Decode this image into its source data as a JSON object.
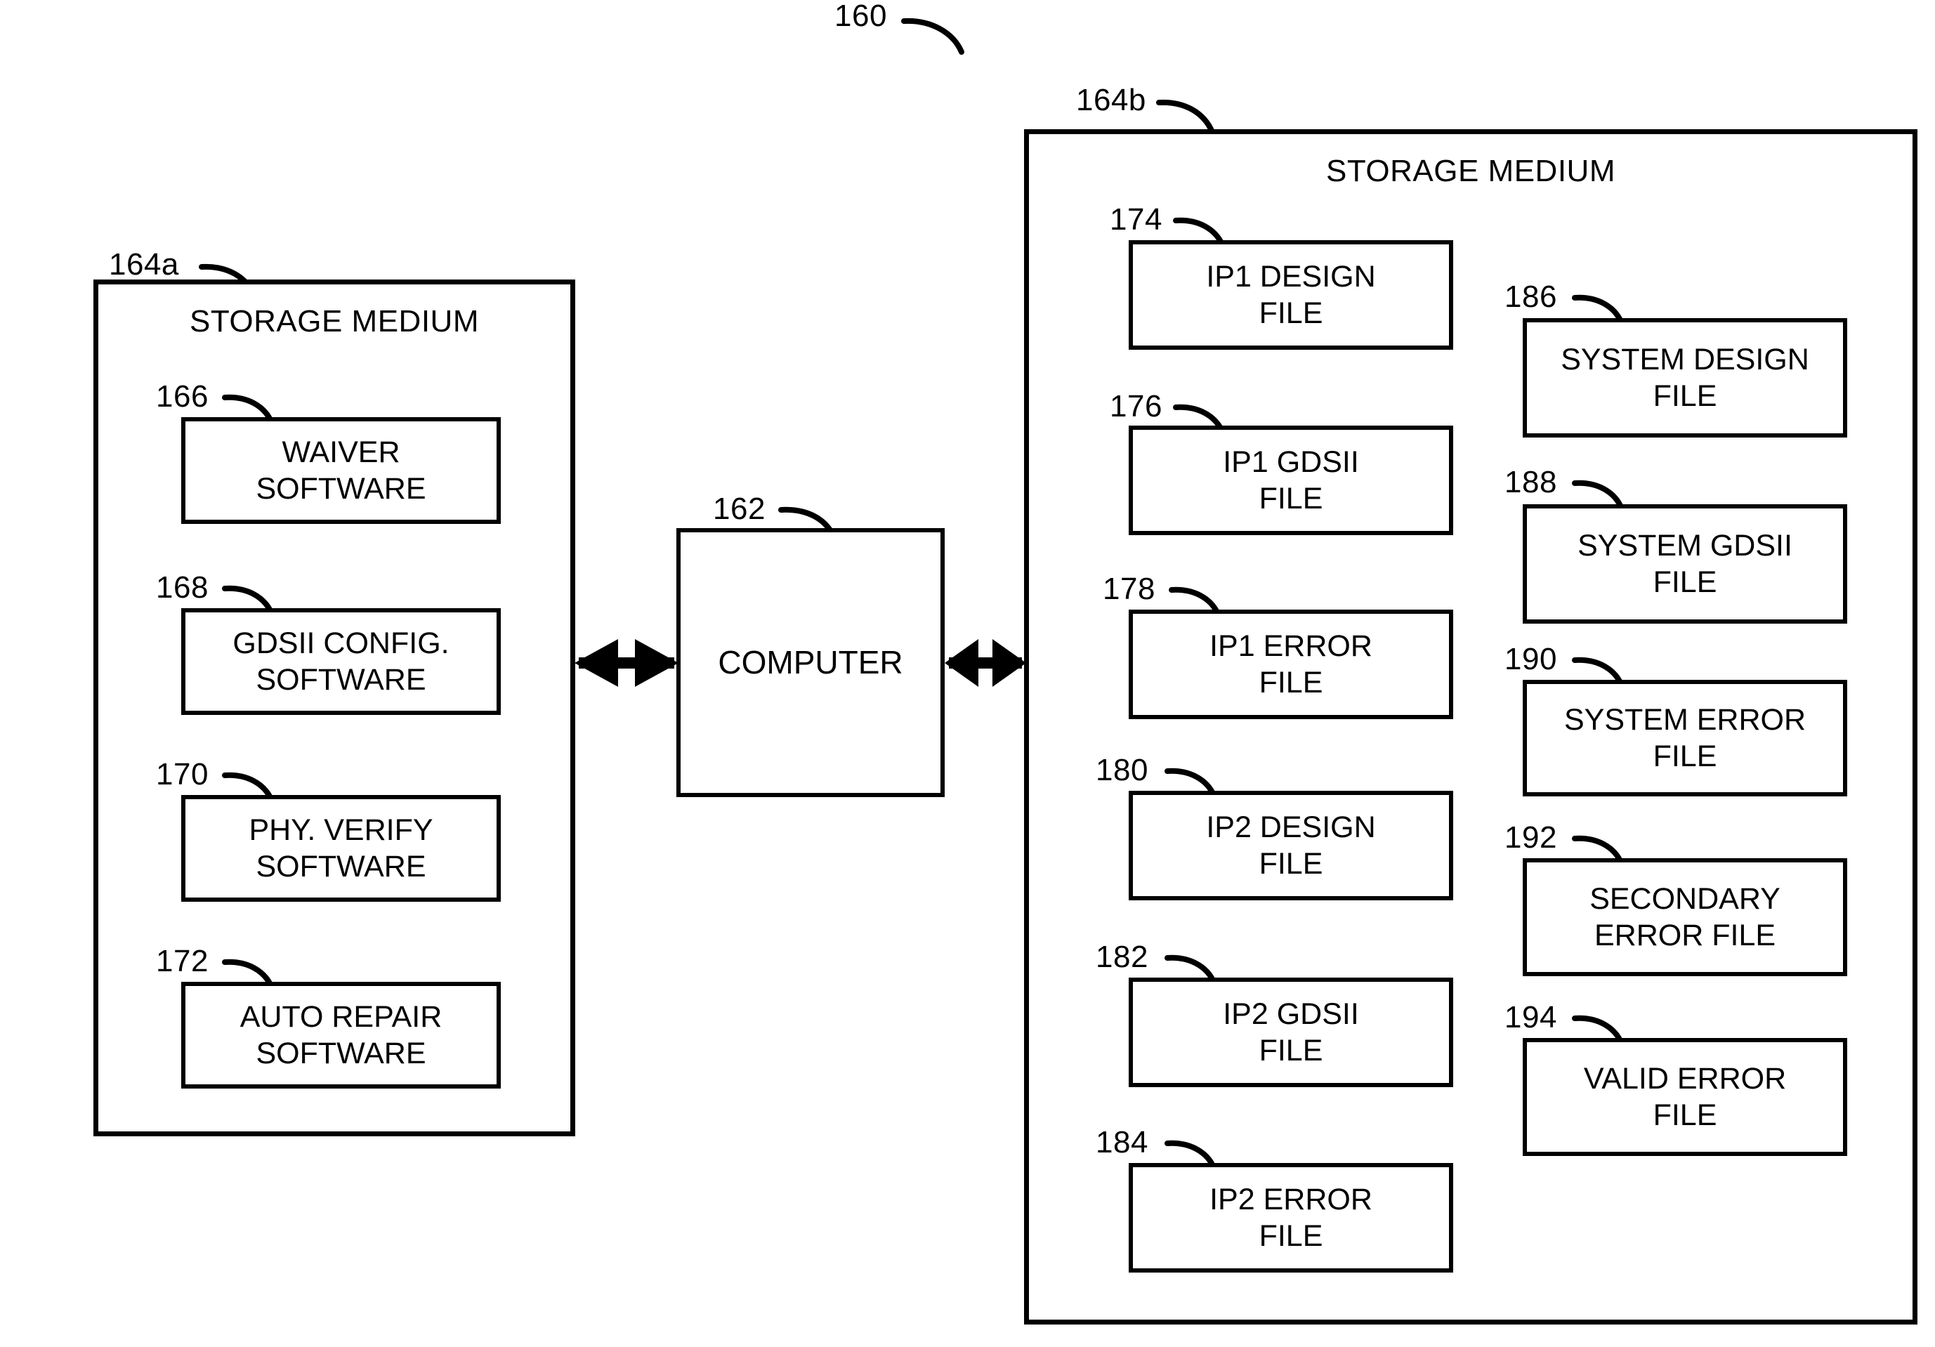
{
  "figure": {
    "figure_ref": "160"
  },
  "left_storage": {
    "ref": "164a",
    "title": "STORAGE MEDIUM",
    "items": [
      {
        "ref": "166",
        "label_line1": "WAIVER",
        "label_line2": "SOFTWARE"
      },
      {
        "ref": "168",
        "label_line1": "GDSII CONFIG.",
        "label_line2": "SOFTWARE"
      },
      {
        "ref": "170",
        "label_line1": "PHY. VERIFY",
        "label_line2": "SOFTWARE"
      },
      {
        "ref": "172",
        "label_line1": "AUTO REPAIR",
        "label_line2": "SOFTWARE"
      }
    ]
  },
  "computer": {
    "ref": "162",
    "label": "COMPUTER"
  },
  "right_storage": {
    "ref": "164b",
    "title": "STORAGE MEDIUM",
    "column_left": [
      {
        "ref": "174",
        "label_line1": "IP1 DESIGN",
        "label_line2": "FILE"
      },
      {
        "ref": "176",
        "label_line1": "IP1 GDSII",
        "label_line2": "FILE"
      },
      {
        "ref": "178",
        "label_line1": "IP1 ERROR",
        "label_line2": "FILE"
      },
      {
        "ref": "180",
        "label_line1": "IP2 DESIGN",
        "label_line2": "FILE"
      },
      {
        "ref": "182",
        "label_line1": "IP2 GDSII",
        "label_line2": "FILE"
      },
      {
        "ref": "184",
        "label_line1": "IP2 ERROR",
        "label_line2": "FILE"
      }
    ],
    "column_right": [
      {
        "ref": "186",
        "label_line1": "SYSTEM DESIGN",
        "label_line2": "FILE"
      },
      {
        "ref": "188",
        "label_line1": "SYSTEM GDSII",
        "label_line2": "FILE"
      },
      {
        "ref": "190",
        "label_line1": "SYSTEM ERROR",
        "label_line2": "FILE"
      },
      {
        "ref": "192",
        "label_line1": "SECONDARY",
        "label_line2": "ERROR FILE"
      },
      {
        "ref": "194",
        "label_line1": "VALID ERROR",
        "label_line2": "FILE"
      }
    ]
  },
  "connections": {
    "left_arrow_name": "computer-to-left-storage-arrow",
    "right_arrow_name": "computer-to-right-storage-arrow"
  },
  "colors": {
    "ink": "#000000",
    "paper": "#ffffff"
  }
}
